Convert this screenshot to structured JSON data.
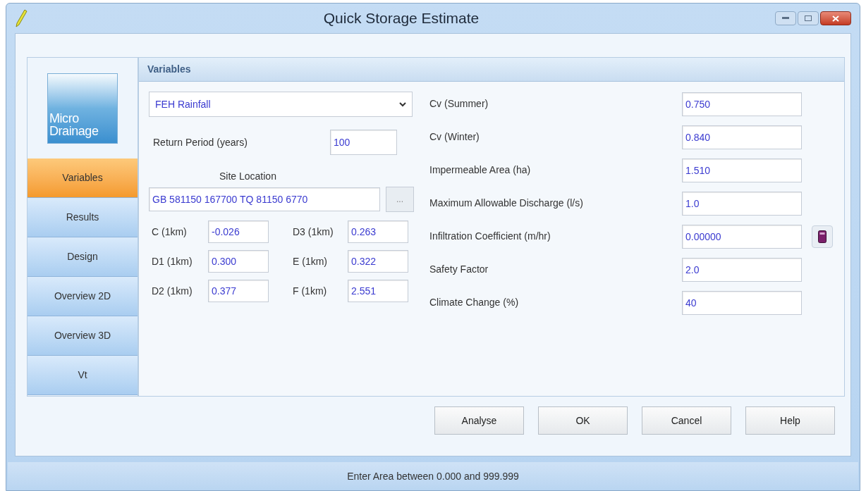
{
  "window": {
    "title": "Quick Storage Estimate"
  },
  "logo": {
    "lines": [
      "Micro",
      "Drainage"
    ]
  },
  "tabs": [
    {
      "label": "Variables",
      "selected": true
    },
    {
      "label": "Results",
      "selected": false
    },
    {
      "label": "Design",
      "selected": false
    },
    {
      "label": "Overview 2D",
      "selected": false
    },
    {
      "label": "Overview 3D",
      "selected": false
    },
    {
      "label": "Vt",
      "selected": false
    }
  ],
  "panel": {
    "title": "Variables",
    "rainfall_dropdown": {
      "value": "FEH Rainfall"
    },
    "return_period": {
      "label": "Return Period (years)",
      "value": "100"
    },
    "site_location": {
      "label": "Site Location",
      "value": "GB 581150 167700 TQ 81150 6770",
      "button": "..."
    },
    "catchment_params": [
      {
        "label": "C (1km)",
        "value": "-0.026"
      },
      {
        "label": "D3 (1km)",
        "value": "0.263"
      },
      {
        "label": "D1 (1km)",
        "value": "0.300"
      },
      {
        "label": "E (1km)",
        "value": "0.322"
      },
      {
        "label": "D2 (1km)",
        "value": "0.377"
      },
      {
        "label": "F (1km)",
        "value": "2.551"
      }
    ],
    "fields": [
      {
        "label": "Cv (Summer)",
        "value": "0.750",
        "calculator": false
      },
      {
        "label": "Cv (Winter)",
        "value": "0.840",
        "calculator": false
      },
      {
        "label": "Impermeable Area (ha)",
        "value": "1.510",
        "calculator": false
      },
      {
        "label": "Maximum Allowable Discharge (l/s)",
        "value": "1.0",
        "calculator": false
      },
      {
        "label": "Infiltration Coefficient (m/hr)",
        "value": "0.00000",
        "calculator": true
      },
      {
        "label": "Safety Factor",
        "value": "2.0",
        "calculator": false
      },
      {
        "label": "Climate Change (%)",
        "value": "40",
        "calculator": false
      }
    ]
  },
  "buttons": [
    "Analyse",
    "OK",
    "Cancel",
    "Help"
  ],
  "status_bar": "Enter Area between 0.000 and 999.999"
}
